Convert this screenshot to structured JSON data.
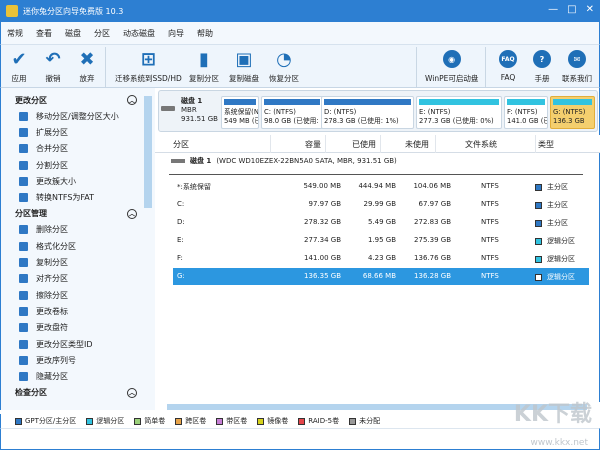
{
  "title": "迷你兔分区向导免费版 10.3",
  "menu": [
    "常规",
    "查看",
    "磁盘",
    "分区",
    "动态磁盘",
    "向导",
    "帮助"
  ],
  "toolbar": {
    "apply": "应用",
    "undo": "撤销",
    "discard": "放弃",
    "migrate": "迁移系统到SSD/HD",
    "copy_partition": "复制分区",
    "copy_disk": "复制磁盘",
    "recover": "恢复分区",
    "winpe": "WinPE可启动盘",
    "faq": "FAQ",
    "manual": "手册",
    "contact": "联系我们",
    "faq_icon_text": "FAQ"
  },
  "sidebar": {
    "sections": [
      {
        "title": "更改分区",
        "items": [
          "移动分区/调整分区大小",
          "扩展分区",
          "合并分区",
          "分割分区",
          "更改簇大小",
          "转换NTFS为FAT"
        ]
      },
      {
        "title": "分区管理",
        "items": [
          "删除分区",
          "格式化分区",
          "复制分区",
          "对齐分区",
          "擦除分区",
          "更改卷标",
          "更改盘符",
          "更改分区类型ID",
          "更改序列号",
          "隐藏分区"
        ]
      },
      {
        "title": "检查分区",
        "items": []
      }
    ]
  },
  "diskmap": {
    "name": "磁盘 1",
    "scheme": "MBR",
    "size": "931.51 GB",
    "partitions": [
      {
        "l1": "系统保留(NTFS)",
        "l2": "549 MB (已使用: 81%)",
        "color": "#2f78c4"
      },
      {
        "l1": "C: (NTFS)",
        "l2": "98.0 GB (已使用: 30%)",
        "color": "#2f78c4"
      },
      {
        "l1": "D: (NTFS)",
        "l2": "278.3 GB (已使用: 1%)",
        "color": "#2f78c4"
      },
      {
        "l1": "E: (NTFS)",
        "l2": "277.3 GB (已使用: 0%)",
        "color": "#31c3e0"
      },
      {
        "l1": "F: (NTFS)",
        "l2": "141.0 GB (已使用: 2%)",
        "color": "#31c3e0"
      },
      {
        "l1": "G: (NTFS)",
        "l2": "136.3 GB",
        "color": "#31c3e0"
      }
    ]
  },
  "table": {
    "headers": [
      "分区",
      "容量",
      "已使用",
      "未使用",
      "文件系统",
      "类型"
    ],
    "disk_label": "磁盘 1",
    "disk_desc": "(WDC WD10EZEX-22BN5A0 SATA, MBR, 931.51 GB)",
    "rows": [
      [
        "*:系统保留",
        "549.00 MB",
        "444.94 MB",
        "104.06 MB",
        "NTFS",
        "主分区"
      ],
      [
        "C:",
        "97.97 GB",
        "29.99 GB",
        "67.97 GB",
        "NTFS",
        "主分区"
      ],
      [
        "D:",
        "278.32 GB",
        "5.49 GB",
        "272.83 GB",
        "NTFS",
        "主分区"
      ],
      [
        "E:",
        "277.34 GB",
        "1.95 GB",
        "275.39 GB",
        "NTFS",
        "逻辑分区"
      ],
      [
        "F:",
        "141.00 GB",
        "4.23 GB",
        "136.76 GB",
        "NTFS",
        "逻辑分区"
      ],
      [
        "G:",
        "136.35 GB",
        "68.66 MB",
        "136.28 GB",
        "NTFS",
        "逻辑分区"
      ]
    ],
    "selected_row": 5
  },
  "legend": [
    {
      "label": "GPT分区/主分区",
      "color": "#2f78c4"
    },
    {
      "label": "逻辑分区",
      "color": "#31c3e0"
    },
    {
      "label": "简单卷",
      "color": "#9ad07a"
    },
    {
      "label": "跨区卷",
      "color": "#e8a44a"
    },
    {
      "label": "带区卷",
      "color": "#c77fd6"
    },
    {
      "label": "镜像卷",
      "color": "#d6d21c"
    },
    {
      "label": "RAID-5卷",
      "color": "#e5454a"
    },
    {
      "label": "未分配",
      "color": "#999999"
    }
  ],
  "watermark": {
    "brand": "KK下载",
    "url": "www.kkx.net"
  }
}
